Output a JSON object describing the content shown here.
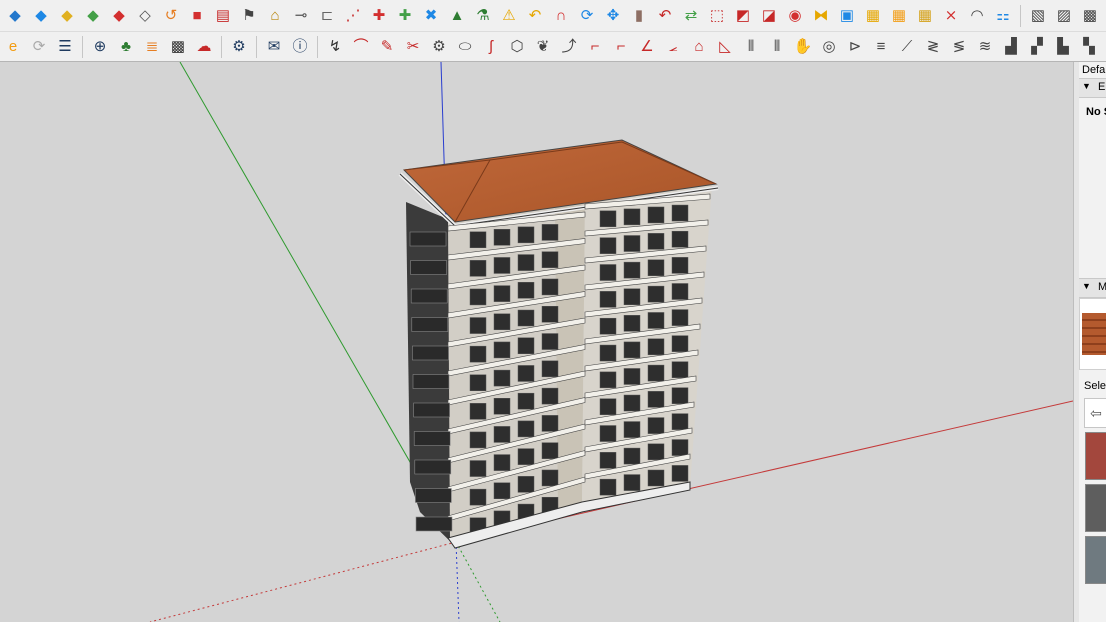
{
  "toolbar_row1": {
    "items": [
      {
        "name": "blue-diamond-icon",
        "glyph": "◆",
        "color": "#2277cc"
      },
      {
        "name": "blue-plane-icon",
        "glyph": "◆",
        "color": "#1e88e5"
      },
      {
        "name": "yellow-plane-icon",
        "glyph": "◆",
        "color": "#e0b020"
      },
      {
        "name": "green-plane-icon",
        "glyph": "◆",
        "color": "#43a047"
      },
      {
        "name": "red-plane-icon",
        "glyph": "◆",
        "color": "#d32f2f"
      },
      {
        "name": "hatched-plane-icon",
        "glyph": "◇",
        "color": "#555555"
      },
      {
        "name": "orange-curve-icon",
        "glyph": "↺",
        "color": "#e67e22"
      },
      {
        "name": "red-square-icon",
        "glyph": "■",
        "color": "#d32f2f"
      },
      {
        "name": "red-grid-icon",
        "glyph": "▤",
        "color": "#c62828"
      },
      {
        "name": "flag-icon",
        "glyph": "⚑",
        "color": "#444444"
      },
      {
        "name": "roof-icon",
        "glyph": "⌂",
        "color": "#b8860b"
      },
      {
        "name": "pipe-icon",
        "glyph": "⊸",
        "color": "#555555"
      },
      {
        "name": "offset-icon",
        "glyph": "⊏",
        "color": "#666666"
      },
      {
        "name": "red-dots-icon",
        "glyph": "⋰",
        "color": "#c62828"
      },
      {
        "name": "red-cross-icon",
        "glyph": "✚",
        "color": "#d32f2f"
      },
      {
        "name": "green-cross-icon",
        "glyph": "✚",
        "color": "#43a047"
      },
      {
        "name": "blue-x-icon",
        "glyph": "✖",
        "color": "#1e88e5"
      },
      {
        "name": "cone-icon",
        "glyph": "▲",
        "color": "#2e7d32"
      },
      {
        "name": "flask-icon",
        "glyph": "⚗",
        "color": "#2e7d32"
      },
      {
        "name": "warning-icon",
        "glyph": "⚠",
        "color": "#e6a700"
      },
      {
        "name": "hook-icon",
        "glyph": "↶",
        "color": "#e6a700"
      },
      {
        "name": "magnet-icon",
        "glyph": "∩",
        "color": "#d32f2f"
      },
      {
        "name": "orbit-icon",
        "glyph": "⟳",
        "color": "#1e88e5"
      },
      {
        "name": "move-icon",
        "glyph": "✥",
        "color": "#1e88e5"
      },
      {
        "name": "cup-icon",
        "glyph": "▮",
        "color": "#8d6e63"
      },
      {
        "name": "undo-red-icon",
        "glyph": "↶",
        "color": "#c62828"
      },
      {
        "name": "green-arrows-icon",
        "glyph": "⇄",
        "color": "#43a047"
      },
      {
        "name": "transform-icon",
        "glyph": "⬚",
        "color": "#c62828"
      },
      {
        "name": "box-red-icon",
        "glyph": "◩",
        "color": "#c62828"
      },
      {
        "name": "box-red2-icon",
        "glyph": "◪",
        "color": "#c62828"
      },
      {
        "name": "red-drop-icon",
        "glyph": "◉",
        "color": "#d32f2f"
      },
      {
        "name": "bowtie-icon",
        "glyph": "⧓",
        "color": "#e6a700"
      },
      {
        "name": "frame-icon",
        "glyph": "▣",
        "color": "#1e88e5"
      },
      {
        "name": "tile-icon",
        "glyph": "▦",
        "color": "#e6a700"
      },
      {
        "name": "grid-orange-icon",
        "glyph": "▦",
        "color": "#f39c12"
      },
      {
        "name": "grid-yellow-icon",
        "glyph": "▦",
        "color": "#d4a017"
      },
      {
        "name": "x-dots-icon",
        "glyph": "⨯",
        "color": "#d32f2f"
      },
      {
        "name": "dotted-arc-icon",
        "glyph": "◠",
        "color": "#444444"
      },
      {
        "name": "nodes-icon",
        "glyph": "⚏",
        "color": "#1e88e5"
      },
      {
        "name": "sep",
        "glyph": "",
        "color": ""
      },
      {
        "name": "component-icon",
        "glyph": "▧",
        "color": "#444444"
      },
      {
        "name": "component2-icon",
        "glyph": "▨",
        "color": "#444444"
      },
      {
        "name": "component3-icon",
        "glyph": "▩",
        "color": "#444444"
      }
    ]
  },
  "toolbar_row2": {
    "items": [
      {
        "name": "extension-warehouse-icon",
        "glyph": "e",
        "color": "#f39c12"
      },
      {
        "name": "refresh-icon",
        "glyph": "⟳",
        "color": "#aaaaaa"
      },
      {
        "name": "layers-icon",
        "glyph": "☰",
        "color": "#1e3a5f"
      },
      {
        "name": "sep",
        "glyph": "",
        "color": ""
      },
      {
        "name": "add-icon",
        "glyph": "⊕",
        "color": "#1e3a5f"
      },
      {
        "name": "tree-icon",
        "glyph": "♣",
        "color": "#2e7d32"
      },
      {
        "name": "layer-stack-icon",
        "glyph": "≣",
        "color": "#e67e22"
      },
      {
        "name": "checker-icon",
        "glyph": "▩",
        "color": "#333333"
      },
      {
        "name": "cloud-upload-icon",
        "glyph": "☁",
        "color": "#c62828"
      },
      {
        "name": "sep",
        "glyph": "",
        "color": ""
      },
      {
        "name": "settings-gear-icon",
        "glyph": "⚙",
        "color": "#1e3a5f"
      },
      {
        "name": "sep",
        "glyph": "",
        "color": ""
      },
      {
        "name": "mail-icon",
        "glyph": "✉",
        "color": "#1e3a5f"
      },
      {
        "name": "info-icon",
        "glyph": "ⓘ",
        "color": "#1e3a5f"
      },
      {
        "name": "sep",
        "glyph": "",
        "color": ""
      },
      {
        "name": "curve-tool-icon",
        "glyph": "↯",
        "color": "#333333"
      },
      {
        "name": "arc-points-icon",
        "glyph": "⌒",
        "color": "#c62828"
      },
      {
        "name": "pencil-icon",
        "glyph": "✎",
        "color": "#c62828"
      },
      {
        "name": "cut-icon",
        "glyph": "✂",
        "color": "#c62828"
      },
      {
        "name": "gear-outline-icon",
        "glyph": "⚙",
        "color": "#444444"
      },
      {
        "name": "blob-icon",
        "glyph": "⬭",
        "color": "#444444"
      },
      {
        "name": "hook-red-icon",
        "glyph": "ʃ",
        "color": "#c62828"
      },
      {
        "name": "box-outline-icon",
        "glyph": "⬡",
        "color": "#444444"
      },
      {
        "name": "brain-icon",
        "glyph": "❦",
        "color": "#444444"
      },
      {
        "name": "branch-icon",
        "glyph": "⤴",
        "color": "#444444"
      },
      {
        "name": "corner-icon",
        "glyph": "⌐",
        "color": "#c62828"
      },
      {
        "name": "corner2-icon",
        "glyph": "⌐",
        "color": "#c62828"
      },
      {
        "name": "angle-icon",
        "glyph": "∠",
        "color": "#c62828"
      },
      {
        "name": "arc-angle-icon",
        "glyph": "⦟",
        "color": "#c62828"
      },
      {
        "name": "arch-icon",
        "glyph": "⌂",
        "color": "#c62828"
      },
      {
        "name": "triangle-icon",
        "glyph": "◺",
        "color": "#c62828"
      },
      {
        "name": "columns-icon",
        "glyph": "⦀",
        "color": "#444444"
      },
      {
        "name": "columns2-icon",
        "glyph": "⦀",
        "color": "#444444"
      },
      {
        "name": "hand-icon",
        "glyph": "✋",
        "color": "#444444"
      },
      {
        "name": "rings-icon",
        "glyph": "◎",
        "color": "#444444"
      },
      {
        "name": "fan-icon",
        "glyph": "⊳",
        "color": "#444444"
      },
      {
        "name": "stairs-icon",
        "glyph": "≡",
        "color": "#444444"
      },
      {
        "name": "ramp-icon",
        "glyph": "⟋",
        "color": "#444444"
      },
      {
        "name": "zigzag-icon",
        "glyph": "≷",
        "color": "#444444"
      },
      {
        "name": "zigzag2-icon",
        "glyph": "≶",
        "color": "#444444"
      },
      {
        "name": "zigzag3-icon",
        "glyph": "≋",
        "color": "#444444"
      },
      {
        "name": "stair-block-icon",
        "glyph": "▟",
        "color": "#444444"
      },
      {
        "name": "stair-block2-icon",
        "glyph": "▞",
        "color": "#444444"
      },
      {
        "name": "flag-block-icon",
        "glyph": "▙",
        "color": "#444444"
      },
      {
        "name": "flag-block2-icon",
        "glyph": "▚",
        "color": "#444444"
      }
    ]
  },
  "tray": {
    "title": "Defa",
    "styles_header": "E",
    "no_selection": "No S",
    "materials_header": "M",
    "select_label": "Selec",
    "swatch_colors": [
      "#b45a2e",
      "#a3473d",
      "#5e5e5e",
      "#6f7a80"
    ]
  },
  "scene": {
    "roof_color": "#c0683a",
    "wall_color": "#ece9e1",
    "window_color": "#2e2e2e",
    "axis_colors": {
      "red": "#c43a3a",
      "green": "#2f9a2f",
      "blue": "#2b3fcf"
    }
  }
}
